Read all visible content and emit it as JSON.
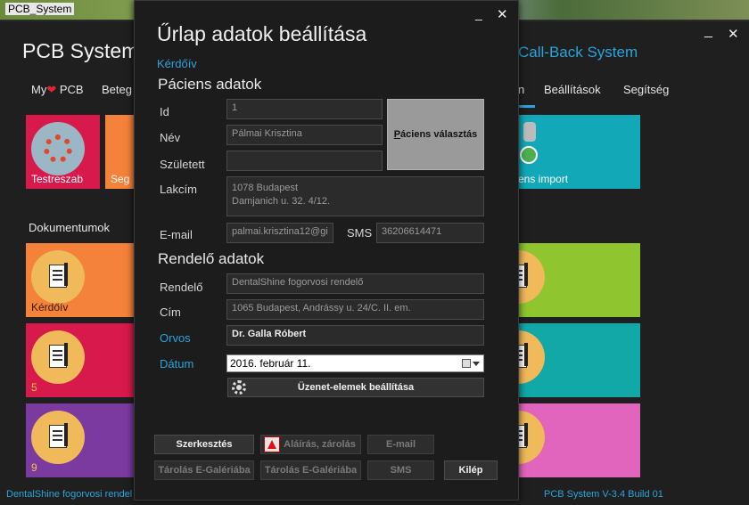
{
  "window": {
    "title": "PCB_System",
    "minimize_glyph": "_",
    "close_glyph": "✕"
  },
  "app": {
    "title": "PCB System",
    "title_right": "Call-Back System",
    "footer_left": "DentalShine fogorvosi rendel",
    "footer_right": "PCB System V-3.4 Build 01"
  },
  "nav": {
    "my_prefix": "My",
    "my_suffix": "PCB",
    "heart": "❤",
    "betegek_partial": "Beteg",
    "import_partial": "n",
    "beallitasok": "Beállítások",
    "segitseg": "Segítség"
  },
  "tiles": {
    "testreszab": "Testreszab",
    "seg_partial": "Seg",
    "import_partial": "ens import",
    "section_label": "Dokumentumok",
    "doc_tiles": [
      {
        "label": "Kérdőív",
        "color": "#f4823a"
      },
      {
        "label": "5",
        "color": "#d8194b"
      },
      {
        "label": "9",
        "color": "#7b3aa0"
      }
    ],
    "right_tiles": [
      {
        "color": "#8fc52e"
      },
      {
        "color": "#12a8a8"
      },
      {
        "color": "#e265bd"
      }
    ]
  },
  "dialog": {
    "title": "Űrlap adatok beállítása",
    "link": "Kérdőív",
    "minimize_glyph": "_",
    "close_glyph": "✕",
    "patient_section": "Páciens adatok",
    "labels": {
      "id": "Id",
      "nev": "Név",
      "szuletett": "Született",
      "lakcim": "Lakcím",
      "email": "E-mail",
      "sms": "SMS",
      "rendelo": "Rendelő",
      "cim": "Cím",
      "orvos": "Orvos",
      "datum": "Dátum"
    },
    "values": {
      "id": "1",
      "nev": "Pálmai Krisztina",
      "szuletett": "",
      "lakcim": "1078 Budapest\nDamjanich u. 32. 4/12.",
      "email": "palmai.krisztina12@gi",
      "sms": "36206614471",
      "rendelo": "DentalShine fogorvosi rendelő",
      "cim": "1065 Budapest, Andrássy u. 24/C. II. em.",
      "orvos": "Dr. Galla Róbert",
      "datum": "2016.    február    11."
    },
    "select_patient_prefix": "P",
    "select_patient_rest": "áciens választás",
    "provider_section": "Rendelő adatok",
    "message_settings_button": "Üzenet-elemek beállítása",
    "buttons": {
      "szerkesztes": "Szerkesztés",
      "alairas": "Aláírás, zárolás",
      "email": "E-mail",
      "tarolas1": "Tárolás E-Galériába",
      "tarolas2": "Tárolás E-Galériába",
      "sms": "SMS",
      "kilep": "Kilép"
    }
  }
}
